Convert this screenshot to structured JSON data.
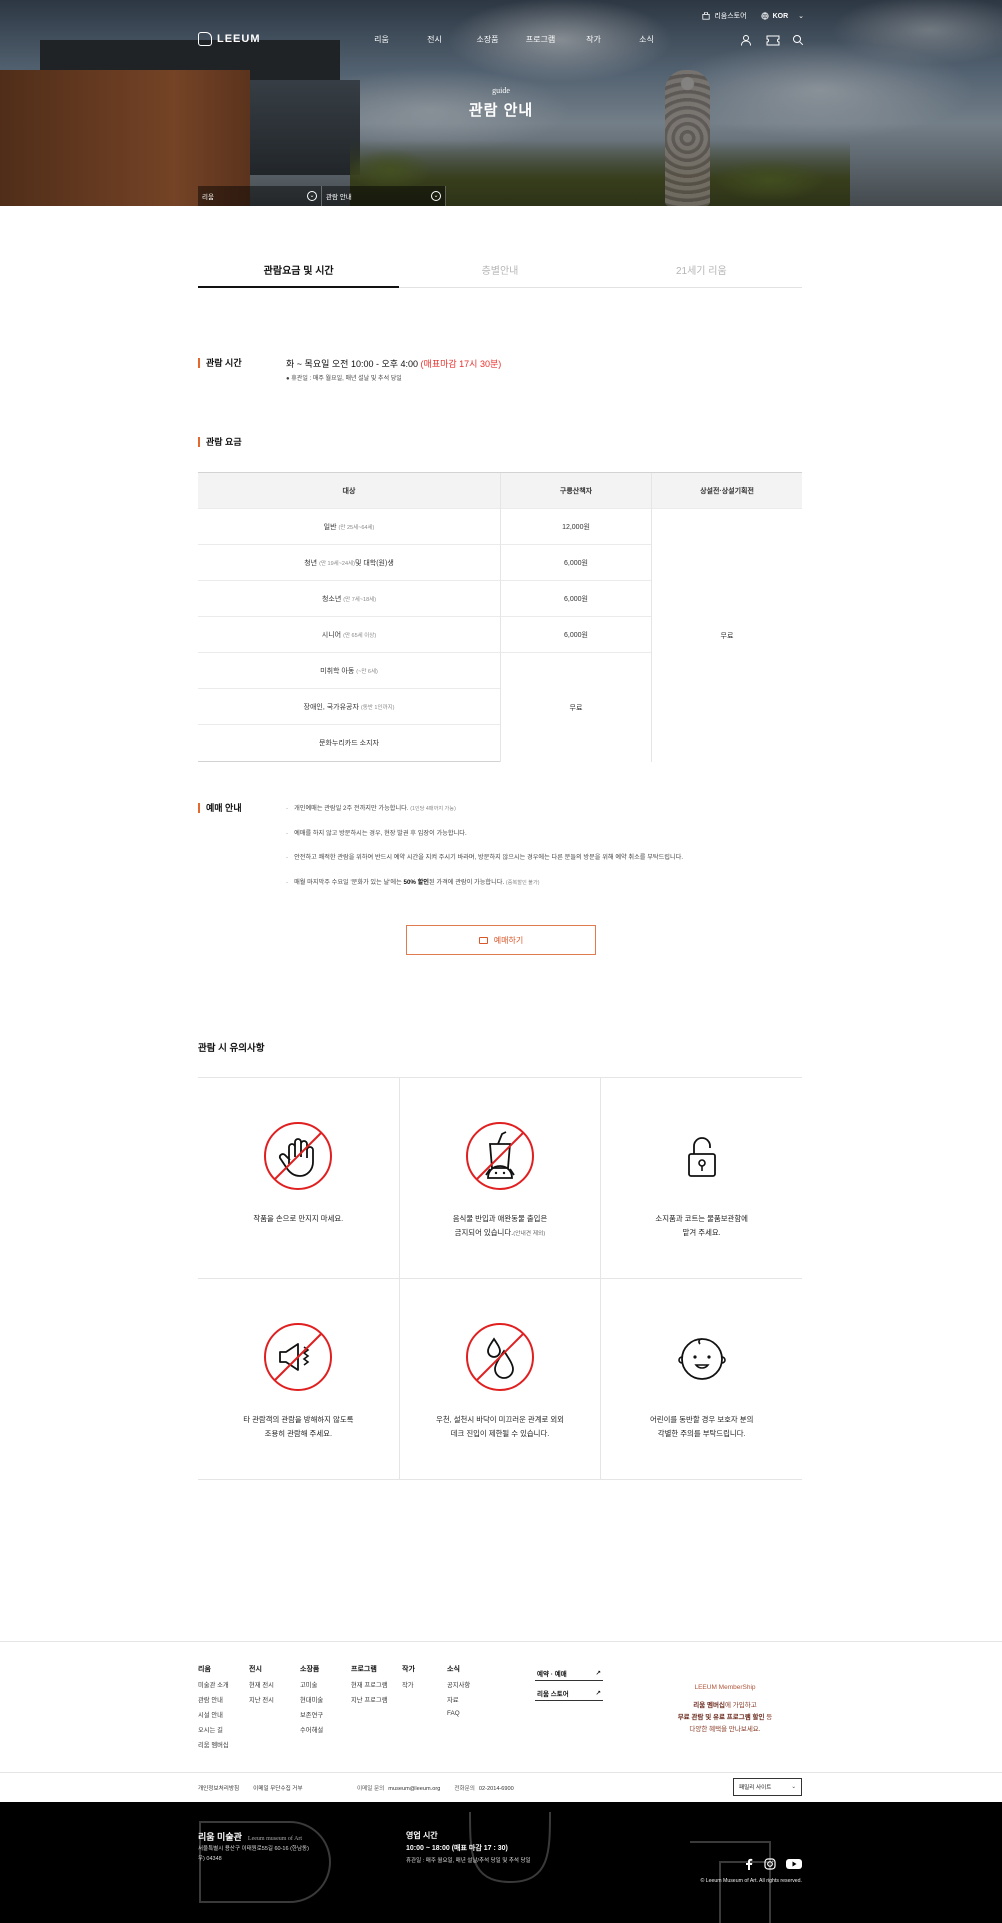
{
  "header": {
    "topbar": {
      "store": "리움스토어",
      "lang": "KOR"
    },
    "logo": "LEEUM",
    "menu": [
      "리움",
      "전시",
      "소장품",
      "프로그램",
      "작가",
      "소식"
    ],
    "hero_sub": "guide",
    "hero_title": "관람 안내",
    "breadcrumb": [
      "리움",
      "관람 안내"
    ]
  },
  "tabs": [
    {
      "label": "관람요금 및 시간",
      "active": true
    },
    {
      "label": "층별안내",
      "active": false
    },
    {
      "label": "21세기 리움",
      "active": false
    }
  ],
  "hours": {
    "label": "관람 시간",
    "line": "화 ~ 목요일 오전 10:00 - 오후 4:00 ",
    "highlight": "(매표마감 17시 30분)",
    "note": "● 휴관일 : 매주 월요일, 매년 설날 및 추석 당일"
  },
  "fee": {
    "label": "관람 요금",
    "headers": [
      "대상",
      "구릉산책자",
      "상설전·상설기획전"
    ],
    "rows": [
      {
        "target": "일반",
        "note": "(만 25세~64세)",
        "price": "12,000원"
      },
      {
        "target": "청년",
        "note": "(만 19세~24세)",
        "suffix": " 및 대학(원)생",
        "price": "6,000원"
      },
      {
        "target": "청소년",
        "note": "(만 7세~18세)",
        "price": "6,000원"
      },
      {
        "target": "시니어",
        "note": "(만 65세 이상)",
        "price": "6,000원"
      },
      {
        "target": "미취학 아동",
        "note": "(~만 6세)",
        "price": ""
      },
      {
        "target": "장애인, 국가유공자",
        "note": "(동반 1인까지)",
        "price": ""
      },
      {
        "target": "문화누리카드 소지자",
        "note": "",
        "price": ""
      }
    ],
    "free_mid": "무료",
    "free_right": "무료"
  },
  "reservation": {
    "label": "예매 안내",
    "items": [
      {
        "text": "개인예매는 관람일 2주 전까지만 가능합니다. ",
        "sm": "(1인당 4매까지 가능)"
      },
      {
        "text": "예매를 하지 않고 방문하시는 경우, 현장 발권 후 입장이 가능합니다.",
        "sm": ""
      },
      {
        "text": "안전하고 쾌적한 관람을 위하여 반드시 예약 시간을 지켜 주시기 바라며, 방문하지 않으시는 경우에는 다른 분들의 방문을 위해 예약 취소를 부탁드립니다.",
        "sm": ""
      },
      {
        "text": "매월 마지막주 수요일 '문화가 있는 날'에는 ",
        "bold": "50% 할인",
        "text2": "된 가격에 관람이 가능합니다. ",
        "sm": "(중복할인 불가)"
      }
    ],
    "button": "예매하기"
  },
  "notices": {
    "title": "관람 시 유의사항",
    "items": [
      {
        "icon": "no-touch-icon",
        "line1": "작품을 손으로 만지지 마세요.",
        "line2": "",
        "sm": ""
      },
      {
        "icon": "no-food-pet-icon",
        "line1": "음식물 반입과 애완동물 출입은",
        "line2": "금지되어 있습니다.",
        "sm": "(안내견 제외)"
      },
      {
        "icon": "lock-icon",
        "line1": "소지품과 코트는 물품보관함에",
        "line2": "맡겨 주세요.",
        "sm": ""
      },
      {
        "icon": "no-noise-icon",
        "line1": "타 관람객의 관람을 방해하지 않도록",
        "line2": "조용히 관람해 주세요.",
        "sm": ""
      },
      {
        "icon": "no-liquid-icon",
        "line1": "우천, 설천시 바닥이 미끄러운 관계로 외외",
        "line2": "데크 진입이 제한될 수 있습니다.",
        "sm": ""
      },
      {
        "icon": "baby-icon",
        "line1": "어린이를 동반할 경우 보호자 분의",
        "line2": "각별한 주의를 부탁드립니다.",
        "sm": ""
      }
    ]
  },
  "footer": {
    "columns": [
      {
        "head": "리움",
        "items": [
          "미술관 소개",
          "관람 안내",
          "시설 안내",
          "오시는 길",
          "리움 멤버십"
        ]
      },
      {
        "head": "전시",
        "items": [
          "현재 전시",
          "지난 전시"
        ]
      },
      {
        "head": "소장품",
        "items": [
          "고미술",
          "현대미술",
          "보존연구",
          "수어해설"
        ]
      },
      {
        "head": "프로그램",
        "items": [
          "현재 프로그램",
          "지난 프로그램"
        ]
      },
      {
        "head": "작가",
        "items": [
          "작가"
        ]
      },
      {
        "head": "소식",
        "items": [
          "공지사항",
          "자료",
          "FAQ"
        ]
      }
    ],
    "quick": [
      "예약 · 예매",
      "리움 스토어"
    ],
    "membership": {
      "title": "LEEUM MemberShip",
      "l1a": "리움 멤버십",
      "l1b": "에 가입하고",
      "l2a": "무료 관람 및 유료 프로그램 할인",
      "l2b": " 등",
      "l3": "다양한 혜택을 만나보세요."
    },
    "links": [
      "개인정보처리방침",
      "이메일 무단수집 거부"
    ],
    "email_label": "이메일 문의",
    "email": "museum@leeum.org",
    "phone_label": "전화문의",
    "phone": "02-2014-6900",
    "family_select": "패밀리 사이트",
    "name": "리움 미술관",
    "name_en": "Leeum museum of Art",
    "address": "서울특별시 용산구 이태원로55길 60-16 (한남동)",
    "zip": "우) 04348",
    "hours_title": "영업 시간",
    "hours": "10:00 ~ 18:00 (매표 마감 17 : 30)",
    "hours_note": "휴관일 : 매주 월요일, 매년 설날/추석 당일 및 추석 당일",
    "copyright": "© Leeum Museum of Art. All rights reserved."
  }
}
